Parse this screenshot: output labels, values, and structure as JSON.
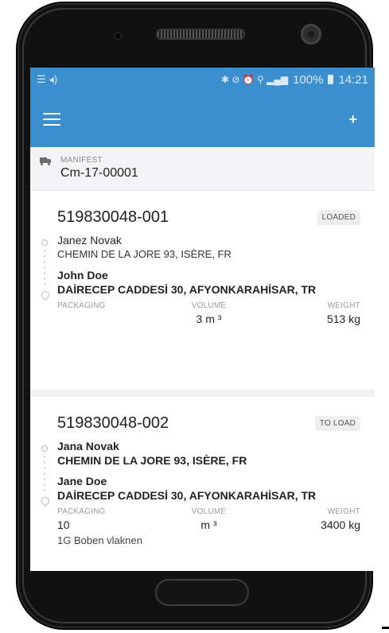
{
  "statusbar": {
    "left_icons": [
      "menu-lines-icon",
      "volume-icon"
    ],
    "left_text": "☰ ◂)",
    "icons_text": "✱ ⊘ ⏰ ⚲ ▂▄▆",
    "battery": "100%",
    "time": "14:21"
  },
  "appbar": {
    "add_label": "+"
  },
  "manifest": {
    "label": "MANIFEST",
    "value": "Cm-17-00001"
  },
  "shipments": [
    {
      "id": "519830048-001",
      "status": "LOADED",
      "sender_name": "Janez Novak",
      "sender_address": "CHEMIN DE LA JORE 93, ISÈRE, FR",
      "recipient_name": "John Doe",
      "recipient_address": "DAİRECEP CADDESİ 30, AFYONKARAHİSAR, TR",
      "packaging_label": "PACKAGING",
      "packaging_value": "",
      "volume_label": "VOLUME",
      "volume_value": "3 m ³",
      "weight_label": "WEIGHT",
      "weight_value": "513 kg"
    },
    {
      "id": "519830048-002",
      "status": "TO LOAD",
      "sender_name": "Jana Novak",
      "sender_address": "CHEMIN DE LA JORE 93, ISÈRE, FR",
      "recipient_name": "Jane Doe",
      "recipient_address": "DAİRECEP CADDESİ 30, AFYONKARAHİSAR, TR",
      "packaging_label": "PACKAGING",
      "packaging_value": "10",
      "volume_label": "VOLUME",
      "volume_value": "m ³",
      "weight_label": "WEIGHT",
      "weight_value": "3400 kg",
      "extra": "1G Boben vlaknen"
    }
  ],
  "colors": {
    "primary": "#3c8fcf"
  }
}
